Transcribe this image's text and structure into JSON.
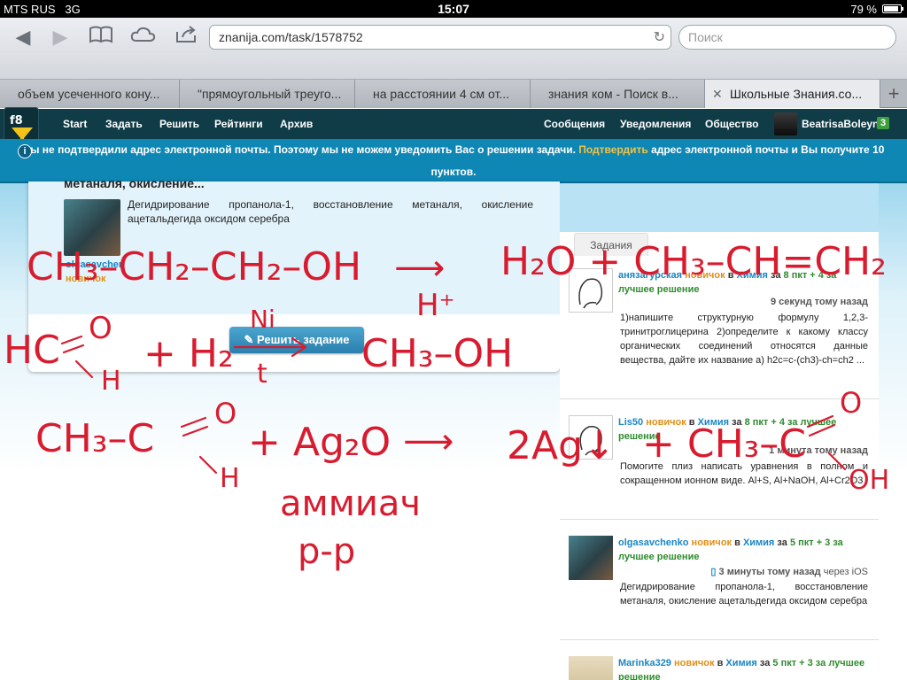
{
  "status_bar": {
    "carrier": "MTS RUS",
    "network": "3G",
    "time": "15:07",
    "battery": "79 %"
  },
  "browser": {
    "url": "znanija.com/task/1578752",
    "search_placeholder": "Поиск"
  },
  "tabs": [
    {
      "label": "объем усеченного кону..."
    },
    {
      "label": "\"прямоугольный треуго..."
    },
    {
      "label": "на расстоянии 4 см от..."
    },
    {
      "label": "знания ком - Поиск в..."
    },
    {
      "label": "Школьные Знания.со..."
    }
  ],
  "nav": {
    "start": "Start",
    "ask": "Задать",
    "solve": "Решить",
    "ratings": "Рейтинги",
    "archive": "Архив",
    "messages": "Сообщения",
    "notifications": "Уведомления",
    "community": "Общество",
    "username": "BeatrisaBoleyn",
    "badge": "3"
  },
  "alert": {
    "text_before": "Вы не подтвердили адрес электронной почты. Поэтому мы не можем уведомить Вас о решении задачи.",
    "confirm": "Подтвердить",
    "text_after": "адрес электронной почты и Вы получите 10 пунктов."
  },
  "task": {
    "title": "метаналя, окисление...",
    "text": "Дегидрирование пропанола-1, восстановление метаналя, окисление ацетальдегида оксидом серебра",
    "user": "olgasavcher",
    "rank": "новичок",
    "solve_label": "Решить задание"
  },
  "sidebar": {
    "tab_label": "Задания",
    "items": [
      {
        "user": "анязагурская",
        "rank": "новичок",
        "in": "в",
        "subject": "Химия",
        "for": "за",
        "points": "8 пкт + 4 за",
        "best": "лучшее решение",
        "time": "9 секунд тому назад",
        "via": "",
        "text": "1)напишите структурную формулу 1,2,3-тринитроглицерина 2)определите к какому классу органических соединений относятся данные вещества, дайте их название а) h2c=c-(ch3)-ch=ch2 ..."
      },
      {
        "user": "Lis50",
        "rank": "новичок",
        "in": "в",
        "subject": "Химия",
        "for": "за",
        "points": "8 пкт + 4 за лучшее",
        "best": "решение",
        "time": "1 минута тому назад",
        "via": "",
        "text": "Помогите плиз написать уравнения в полном и сокращенном ионном виде. Al+S, Al+NaOH, Al+Cr2O3"
      },
      {
        "user": "olgasavchenko",
        "rank": "новичок",
        "in": "в",
        "subject": "Химия",
        "for": "за",
        "points": "5 пкт + 3 за",
        "best": "лучшее решение",
        "time": "3 минуты тому назад",
        "via": "через iOS",
        "text": "Дегидрирование пропанола-1, восстановление метаналя, окисление ацетальдегида оксидом серебра"
      },
      {
        "user": "Marinka329",
        "rank": "новичок",
        "in": "в",
        "subject": "Химия",
        "for": "за",
        "points": "5 пкт + 3 за",
        "best": "лучшее решение",
        "time": "",
        "via": "",
        "text": ""
      }
    ]
  },
  "handwriting": {
    "eq1_left": "CH₃–CH₂–CH₂–OH",
    "eq1_arrow": "⟶",
    "eq1_cond": "H⁺",
    "eq1_right": "H₂O + CH₃–CH=CH₂",
    "eq2_left": "HC",
    "eq2_o": "O",
    "eq2_h": "H",
    "eq2_plus": "+ H₂",
    "eq2_cond_top": "Ni",
    "eq2_cond_bot": "t",
    "eq2_right": "CH₃–OH",
    "eq3_left": "CH₃–C",
    "eq3_o": "O",
    "eq3_h": "H",
    "eq3_plus": "+ Ag₂O",
    "eq3_arrow": "⟶",
    "eq3_right_ag": "2Ag↓",
    "eq3_right_acid": "+ CH₃–C",
    "eq3_right_o": "O",
    "eq3_right_oh": "OH",
    "note1": "аммиач",
    "note2": "р-р"
  }
}
